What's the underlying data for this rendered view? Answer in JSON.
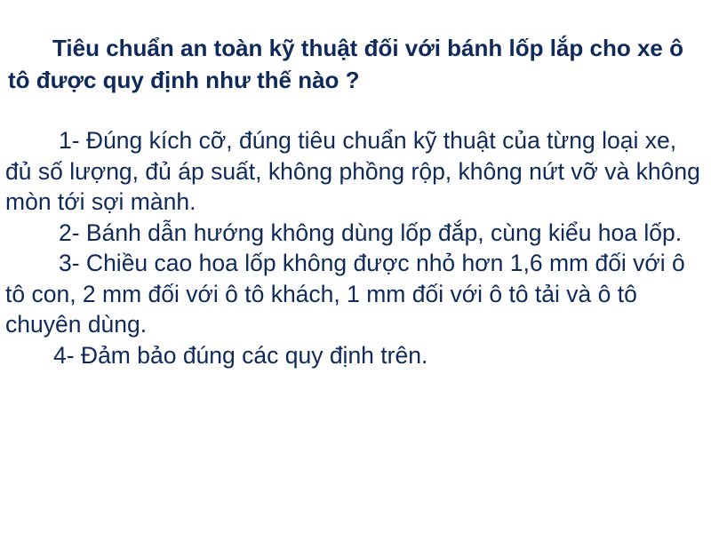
{
  "question": "Tiêu chuẩn an toàn kỹ thuật đối với bánh lốp lắp cho xe ô tô được quy định như thế nào ?",
  "answers": [
    "1- Đúng kích cỡ, đúng tiêu chuẩn kỹ thuật của từng loại xe, đủ số lượng, đủ áp suất, không phồng rộp, không nứt vỡ và không mòn tới sợi mành.",
    "2- Bánh dẫn hướng không dùng lốp đắp, cùng kiểu hoa lốp.",
    "3- Chiều cao hoa lốp không được nhỏ hơn 1,6 mm đối với ô tô con, 2 mm đối với ô tô khách, 1 mm đối với ô tô tải và ô tô chuyên dùng.",
    "4- Đảm bảo đúng các quy định trên."
  ],
  "colors": {
    "text": "#0f2a5a",
    "background": "#ffffff"
  }
}
